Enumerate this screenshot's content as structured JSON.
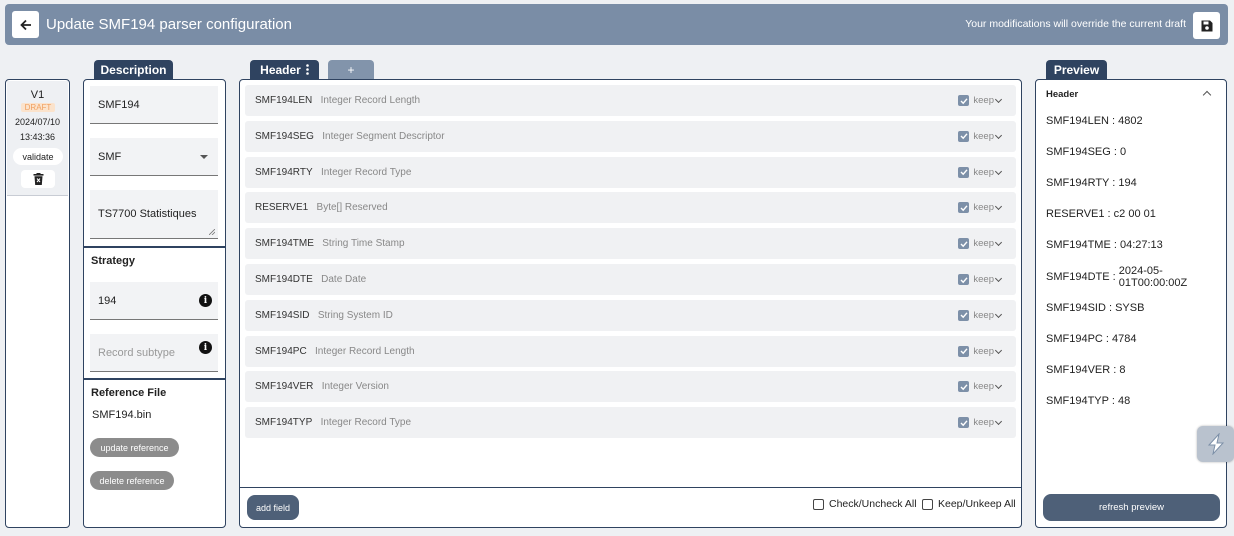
{
  "header": {
    "title": "Update SMF194 parser configuration",
    "note": "Your modifications will override the current draft",
    "back_icon": "arrow-left-icon",
    "save_icon": "floppy-disk-icon"
  },
  "version": {
    "label": "V1",
    "status": "DRAFT",
    "date": "2024/07/10",
    "time": "13:43:36",
    "validate_label": "validate",
    "delete_icon": "trash-icon"
  },
  "description": {
    "tab_label": "Description",
    "name_value": "SMF194",
    "type_value": "SMF",
    "text_value": "TS7700 Statistiques",
    "strategy_title": "Strategy",
    "record_type_value": "194",
    "record_subtype_placeholder": "Record subtype",
    "reference_title": "Reference File",
    "reference_file": "SMF194.bin",
    "update_reference_label": "update reference",
    "delete_reference_label": "delete reference"
  },
  "fields_tabs": {
    "header_label": "Header",
    "add_label": "+"
  },
  "fields": [
    {
      "name": "SMF194LEN",
      "type": "Integer Record Length",
      "keep": "keep",
      "checked": true
    },
    {
      "name": "SMF194SEG",
      "type": "Integer Segment Descriptor",
      "keep": "keep",
      "checked": true
    },
    {
      "name": "SMF194RTY",
      "type": "Integer Record Type",
      "keep": "keep",
      "checked": true
    },
    {
      "name": "RESERVE1",
      "type": "Byte[] Reserved",
      "keep": "keep",
      "checked": true
    },
    {
      "name": "SMF194TME",
      "type": "String Time Stamp",
      "keep": "keep",
      "checked": true
    },
    {
      "name": "SMF194DTE",
      "type": "Date Date",
      "keep": "keep",
      "checked": true
    },
    {
      "name": "SMF194SID",
      "type": "String System ID",
      "keep": "keep",
      "checked": true
    },
    {
      "name": "SMF194PC",
      "type": "Integer Record Length",
      "keep": "keep",
      "checked": true
    },
    {
      "name": "SMF194VER",
      "type": "Integer Version",
      "keep": "keep",
      "checked": true
    },
    {
      "name": "SMF194TYP",
      "type": "Integer Record Type",
      "keep": "keep",
      "checked": true
    }
  ],
  "fields_footer": {
    "add_field_label": "add field",
    "check_all_label": "Check/Uncheck All",
    "keep_all_label": "Keep/Unkeep All"
  },
  "preview": {
    "tab_label": "Preview",
    "section_title": "Header",
    "items": [
      {
        "key": "SMF194LEN",
        "value": "4802"
      },
      {
        "key": "SMF194SEG",
        "value": "0"
      },
      {
        "key": "SMF194RTY",
        "value": "194"
      },
      {
        "key": "RESERVE1",
        "value": "c2 00 01"
      },
      {
        "key": "SMF194TME",
        "value": "04:27:13"
      },
      {
        "key": "SMF194DTE",
        "value": "2024-05-01T00:00:00Z"
      },
      {
        "key": "SMF194SID",
        "value": "SYSB"
      },
      {
        "key": "SMF194PC",
        "value": "4784"
      },
      {
        "key": "SMF194VER",
        "value": "8"
      },
      {
        "key": "SMF194TYP",
        "value": "48"
      }
    ],
    "refresh_label": "refresh preview"
  },
  "colors": {
    "navy": "#2f4360",
    "topbar": "#7a8da6",
    "button_dark": "#4e6078",
    "draft": "#f0a060"
  }
}
